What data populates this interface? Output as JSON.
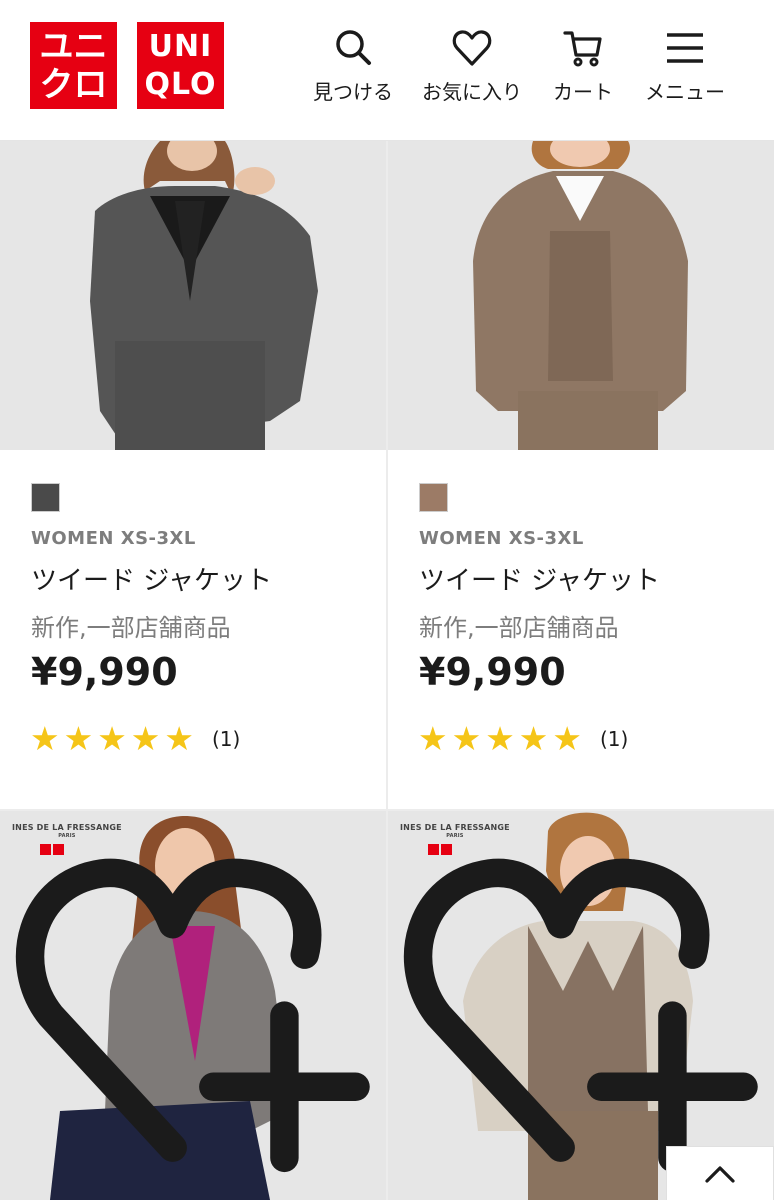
{
  "header": {
    "logo_ja_top": "ユニ",
    "logo_ja_bottom": "クロ",
    "logo_en_top": "UNI",
    "logo_en_bottom": "QLO",
    "nav": [
      {
        "label": "見つける",
        "icon": "search-icon"
      },
      {
        "label": "お気に入り",
        "icon": "heart-icon"
      },
      {
        "label": "カート",
        "icon": "cart-icon"
      },
      {
        "label": "メニュー",
        "icon": "menu-icon"
      }
    ]
  },
  "brand_color": "#e60012",
  "star_color": "#f5c518",
  "products": [
    {
      "swatch_color": "#4a4a4a",
      "gender_size": "WOMEN XS-3XL",
      "name": "ツイード ジャケット",
      "flags": "新作,一部店舗商品",
      "price": "¥9,990",
      "rating": 5,
      "review_count": "(1)"
    },
    {
      "swatch_color": "#9c7b66",
      "gender_size": "WOMEN XS-3XL",
      "name": "ツイード ジャケット",
      "flags": "新作,一部店舗商品",
      "price": "¥9,990",
      "rating": 5,
      "review_count": "(1)"
    }
  ],
  "collab": {
    "brand_line1": "INES DE LA FRESSANGE",
    "brand_line2": "PARIS"
  },
  "stars": [
    "★",
    "★",
    "★",
    "★",
    "★"
  ]
}
